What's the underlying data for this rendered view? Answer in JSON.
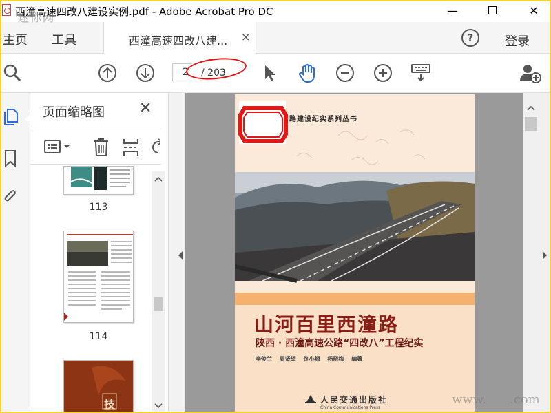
{
  "window": {
    "title": "西潼高速四改八建设实例.pdf - Adobe Acrobat Pro DC",
    "minimize": "—",
    "maximize": "☐",
    "close": "✕"
  },
  "tabs": {
    "home": "主页",
    "tools": "工具",
    "document": "西潼高速四改八建...",
    "document_close": "×",
    "help": "?",
    "login": "登录"
  },
  "toolbar": {
    "page_current": "2",
    "page_total": "/ 203"
  },
  "panel": {
    "title": "页面缩略图",
    "close": "✕",
    "thumbnails": [
      {
        "label": "113"
      },
      {
        "label": "114"
      },
      {
        "label": ""
      }
    ],
    "thumb3_text": "技"
  },
  "cover": {
    "series": "路建设纪实系列丛书",
    "title": "山河百里西潼路",
    "subtitle": "陕西 · 西潼高速公路“四改八”工程纪实",
    "authors": [
      "李俊兰",
      "周贤望",
      "佟小翘",
      "杨晓梅",
      "编著"
    ],
    "publisher": "人民交通出版社",
    "publisher_en": "China Communications Press"
  },
  "watermarks": {
    "top_left": "迷你网",
    "bottom_right": "www.      .com"
  },
  "colors": {
    "accent": "#2e6bd8",
    "cover_bg": "#fbe9d9",
    "cover_band": "#f6b070",
    "title_red": "#8b1d14",
    "stamp_red": "#e01818"
  }
}
